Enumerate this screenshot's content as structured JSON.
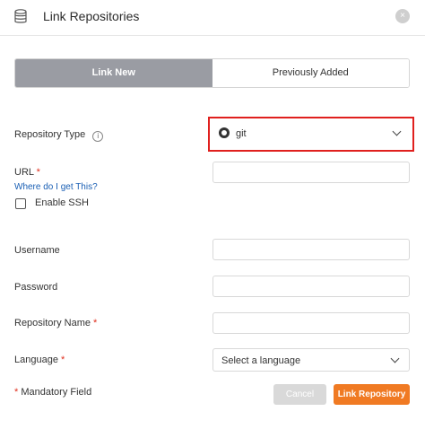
{
  "header": {
    "title": "Link Repositories",
    "close": "×"
  },
  "tabs": [
    {
      "label": "Link New"
    },
    {
      "label": "Previously Added"
    }
  ],
  "form": {
    "repository_type": {
      "label": "Repository Type",
      "info": "i",
      "value": "git"
    },
    "url": {
      "label": "URL",
      "required_marker": "*",
      "help_link": "Where do I get This?"
    },
    "enable_ssh": {
      "label": "Enable SSH",
      "checked": false
    },
    "username": {
      "label": "Username"
    },
    "password": {
      "label": "Password"
    },
    "repository_name": {
      "label": "Repository Name",
      "required_marker": "*"
    },
    "language": {
      "label": "Language",
      "required_marker": "*",
      "placeholder": "Select a language"
    },
    "mandatory_note": {
      "marker": "*",
      "text": "Mandatory Field"
    }
  },
  "buttons": {
    "cancel": "Cancel",
    "link": "Link Repository"
  },
  "colors": {
    "accent": "#f07a23",
    "active_tab": "#9a9ca3",
    "highlight": "#e0201e",
    "link": "#1a5fb4"
  }
}
